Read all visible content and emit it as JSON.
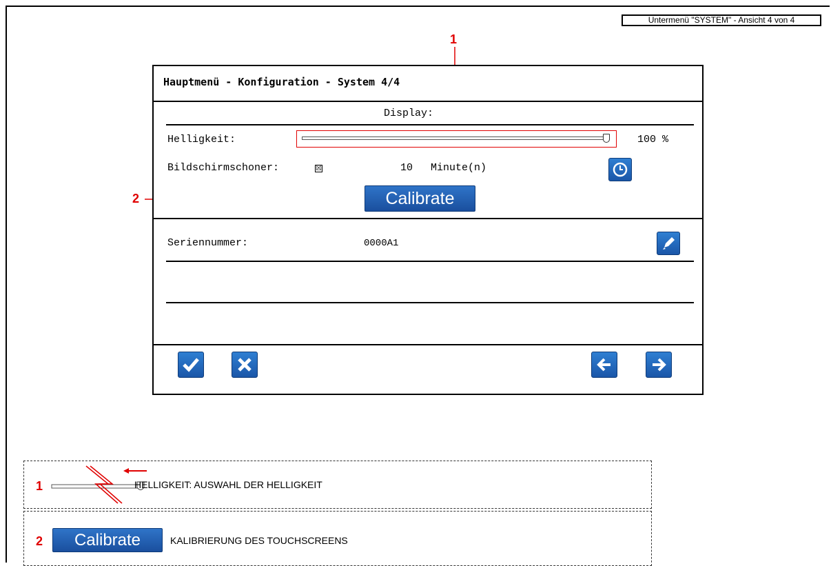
{
  "header_tag": "Untermenü \"SYSTEM\" - Ansicht 4 von 4",
  "callouts": {
    "one": "1",
    "two": "2"
  },
  "panel": {
    "title": "Hauptmenü - Konfiguration - System 4/4",
    "display_label": "Display:",
    "brightness": {
      "label": "Helligkeit:",
      "value_text": "100 %",
      "level_percent": 100
    },
    "screensaver": {
      "label": "Bildschirmschoner:",
      "checkbox_mark": "☒",
      "checked": true,
      "value": "10",
      "unit": "Minute(n)"
    },
    "calibrate_label": "Calibrate",
    "serial": {
      "label": "Seriennummer:",
      "value": "0000A1"
    }
  },
  "legend": [
    {
      "number": "1",
      "text": "HELLIGKEIT: AUSWAHL DER HELLIGKEIT"
    },
    {
      "number": "2",
      "button_label": "Calibrate",
      "text": "KALIBRIERUNG DES TOUCHSCREENS"
    }
  ],
  "icons": [
    "clock-icon",
    "pencil-icon",
    "checkmark-icon",
    "close-icon",
    "arrow-left-icon",
    "arrow-right-icon"
  ],
  "colors": {
    "accent": "#e00000",
    "button_blue": "#1f5fae"
  }
}
